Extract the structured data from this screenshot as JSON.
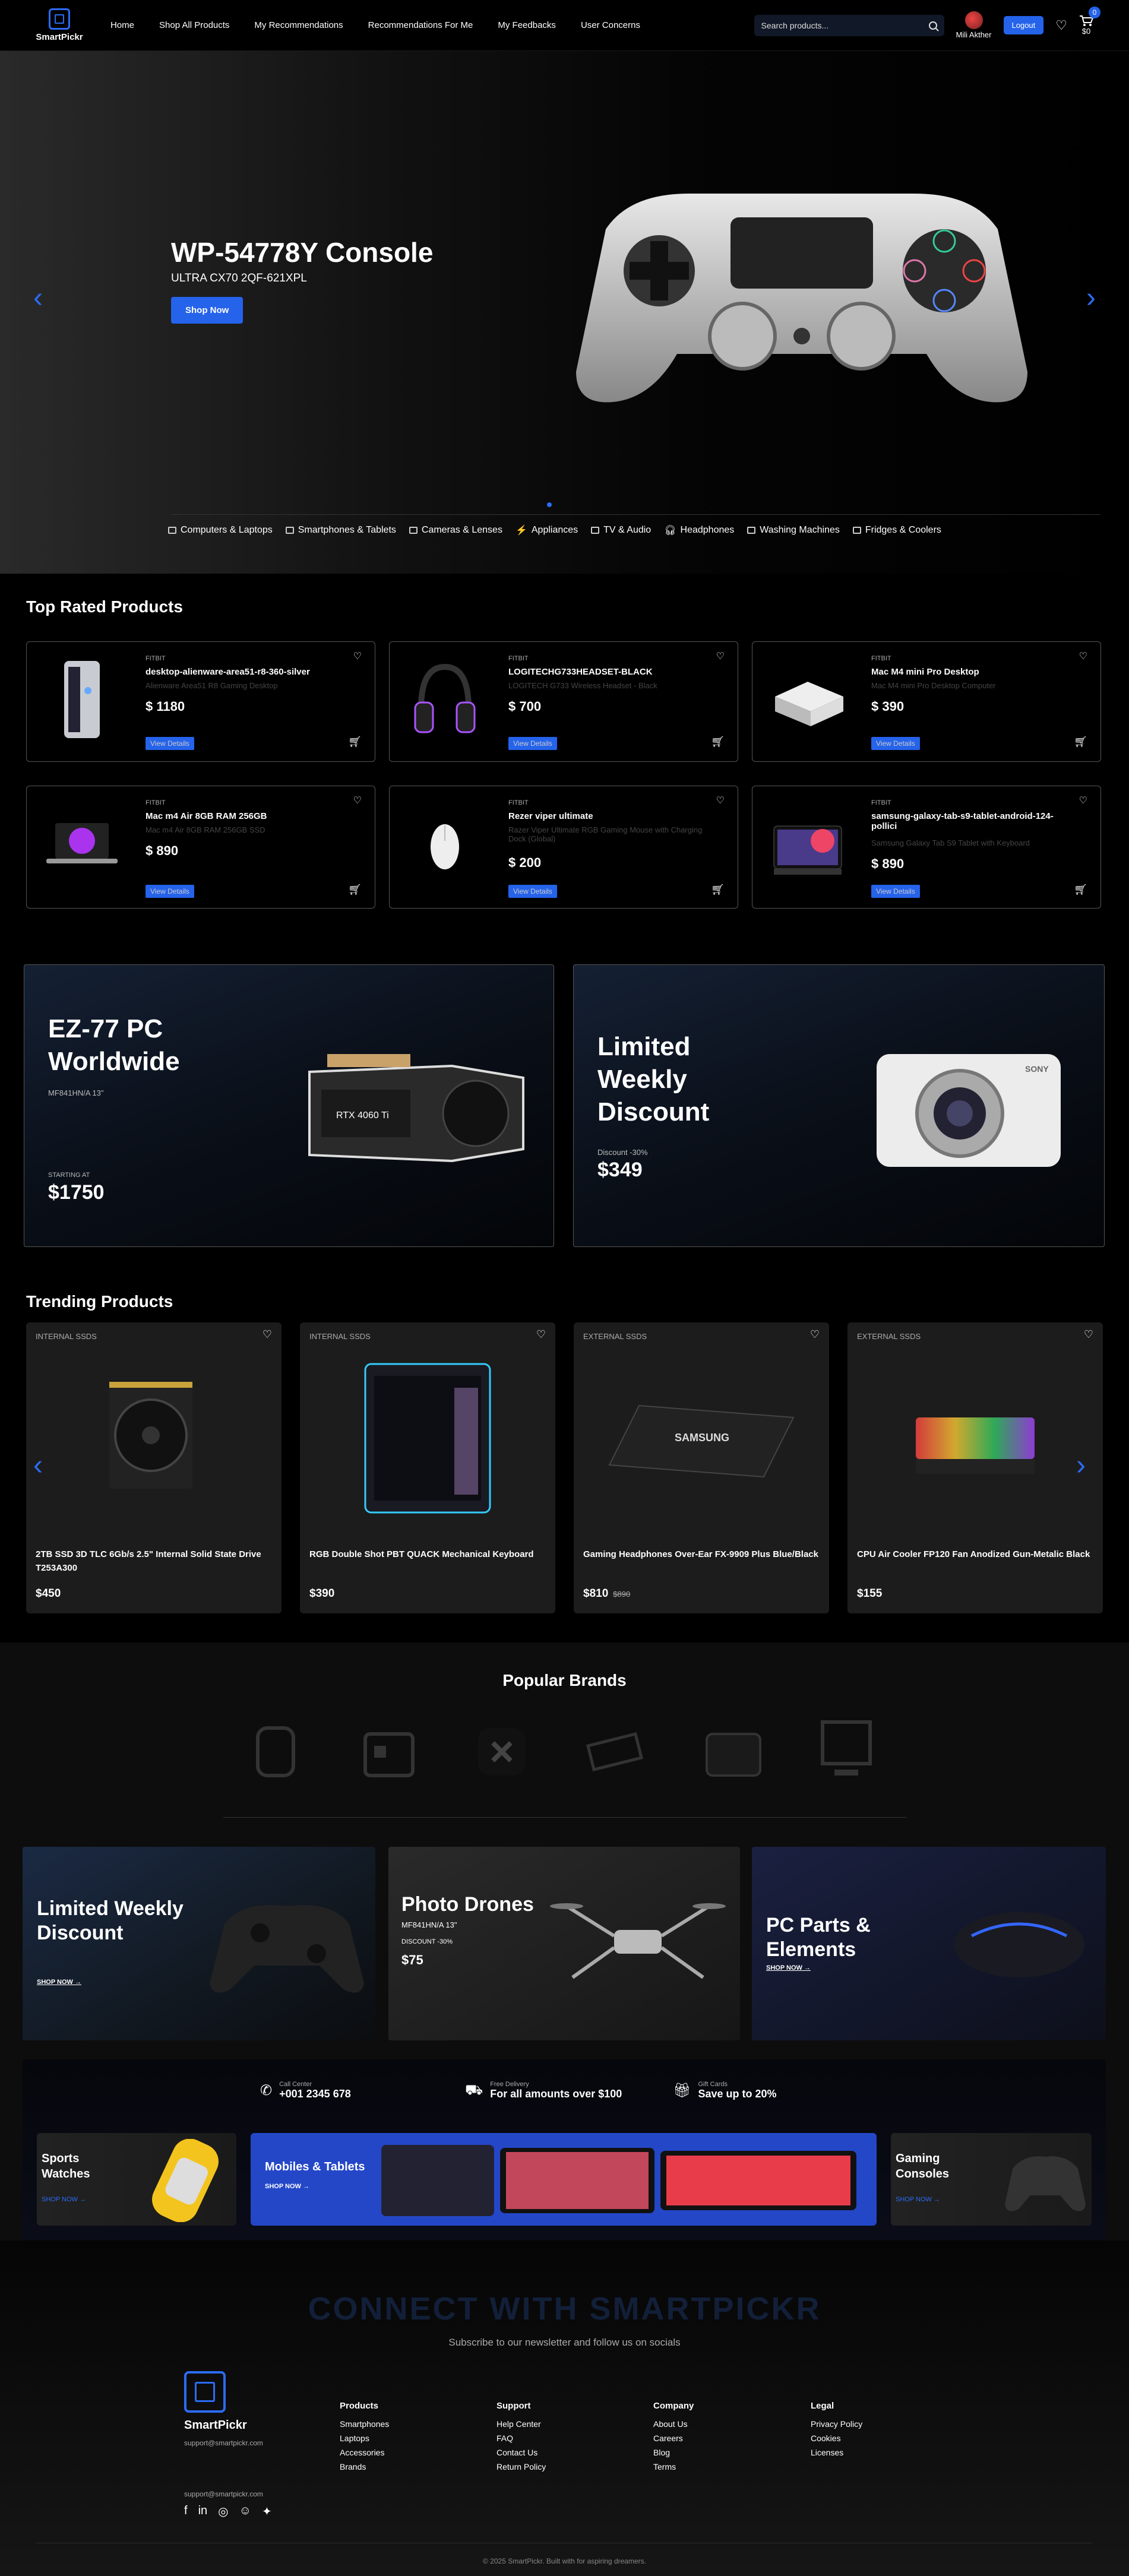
{
  "nav": {
    "logo": "SmartPickr",
    "links": [
      "Home",
      "Shop All Products",
      "My Recommendations",
      "Recommendations For Me",
      "My Feedbacks",
      "User Concerns"
    ],
    "search_placeholder": "Search products...",
    "user": "Mili Akther",
    "logout": "Logout",
    "cart_count": "0",
    "cart_total": "$0"
  },
  "hero": {
    "title": "WP-54778Y Console",
    "subtitle": "ULTRA CX70 2QF-621XPL",
    "button": "Shop Now"
  },
  "categories": [
    "Computers & Laptops",
    "Smartphones & Tablets",
    "Cameras & Lenses",
    "Appliances",
    "TV & Audio",
    "Headphones",
    "Washing Machines",
    "Fridges & Coolers"
  ],
  "top_rated": {
    "title": "Top Rated Products",
    "view": "View Details",
    "items": [
      {
        "brand": "FITBIT",
        "name": "desktop-alienware-area51-r8-360-silver",
        "desc": "Alienware Area51 R8 Gaming Desktop",
        "price": "$ 1180"
      },
      {
        "brand": "FITBIT",
        "name": "LOGITECHG733HEADSET-BLACK",
        "desc": "LOGITECH G733 Wireless Headset - Black",
        "price": "$ 700"
      },
      {
        "brand": "FITBIT",
        "name": "Mac M4 mini Pro Desktop",
        "desc": "Mac M4 mini Pro Desktop Computer",
        "price": "$ 390"
      },
      {
        "brand": "FITBIT",
        "name": "Mac m4 Air 8GB RAM 256GB",
        "desc": "Mac m4 Air 8GB RAM 256GB SSD",
        "price": "$ 890"
      },
      {
        "brand": "FITBIT",
        "name": "Rezer viper ultimate",
        "desc": "Razer Viper Ultimate RGB Gaming Mouse with Charging Dock (Global)",
        "price": "$ 200"
      },
      {
        "brand": "FITBIT",
        "name": "samsung-galaxy-tab-s9-tablet-android-124-pollici",
        "desc": "Samsung Galaxy Tab S9 Tablet with Keyboard",
        "price": "$ 890"
      }
    ]
  },
  "promo1": {
    "title": "EZ-77 PC Worldwide",
    "sub": "MF841HN/A 13\"",
    "starting": "STARTING AT",
    "price": "$1750",
    "gpu": "RTX 4060 Ti"
  },
  "promo2": {
    "title": "Limited Weekly Discount",
    "sub": "Discount -30%",
    "price": "$349",
    "cam": "SONY"
  },
  "trending": {
    "title": "Trending Products",
    "items": [
      {
        "cat": "INTERNAL SSDS",
        "name": "2TB SSD 3D TLC 6Gb/s 2.5\" Internal Solid State Drive T253A300",
        "price": "$450",
        "old": ""
      },
      {
        "cat": "INTERNAL SSDS",
        "name": "RGB Double Shot PBT QUACK Mechanical Keyboard",
        "price": "$390",
        "old": ""
      },
      {
        "cat": "EXTERNAL SSDS",
        "name": "Gaming Headphones Over-Ear FX-9909 Plus Blue/Black",
        "price": "$810",
        "old": "$890"
      },
      {
        "cat": "EXTERNAL SSDS",
        "name": "CPU Air Cooler FP120 Fan Anodized Gun-Metalic Black",
        "price": "$155",
        "old": ""
      }
    ],
    "ssd": "SAMSUNG"
  },
  "brands": {
    "title": "Popular Brands"
  },
  "banners": [
    {
      "title": "Limited Weekly Discount",
      "link": "SHOP NOW →"
    },
    {
      "title": "Photo Drones",
      "sub": "MF841HN/A 13\"",
      "small": "DISCOUNT -30%",
      "price": "$75"
    },
    {
      "title": "PC Parts & Elements",
      "link": "SHOP NOW →"
    }
  ],
  "info": [
    {
      "label": "Call Center",
      "value": "+001 2345 678"
    },
    {
      "label": "Free Delivery",
      "value": "For all amounts over $100"
    },
    {
      "label": "Gift Cards",
      "value": "Save up to 20%"
    }
  ],
  "mini": [
    {
      "title": "Sports Watches",
      "link": "SHOP NOW →"
    },
    {
      "title": "Mobiles & Tablets",
      "link": "SHOP NOW →"
    },
    {
      "title": "Gaming Consoles",
      "link": "SHOP NOW →"
    }
  ],
  "footer": {
    "big": "CONNECT WITH SMARTPICKR",
    "sub": "Subscribe to our newsletter and follow us on socials",
    "logo": "SmartPickr",
    "email": "support@smartpickr.com",
    "cols": [
      {
        "title": "Products",
        "items": [
          "Smartphones",
          "Laptops",
          "Accessories",
          "Brands"
        ]
      },
      {
        "title": "Support",
        "items": [
          "Help Center",
          "FAQ",
          "Contact Us",
          "Return Policy"
        ]
      },
      {
        "title": "Company",
        "items": [
          "About Us",
          "Careers",
          "Blog",
          "Terms"
        ]
      },
      {
        "title": "Legal",
        "items": [
          "Privacy Policy",
          "Cookies",
          "Licenses"
        ]
      }
    ],
    "copy": "© 2025 SmartPickr. Built with for aspiring dreamers."
  },
  "colors": {
    "accent": "#2563eb",
    "bg": "#000000"
  }
}
